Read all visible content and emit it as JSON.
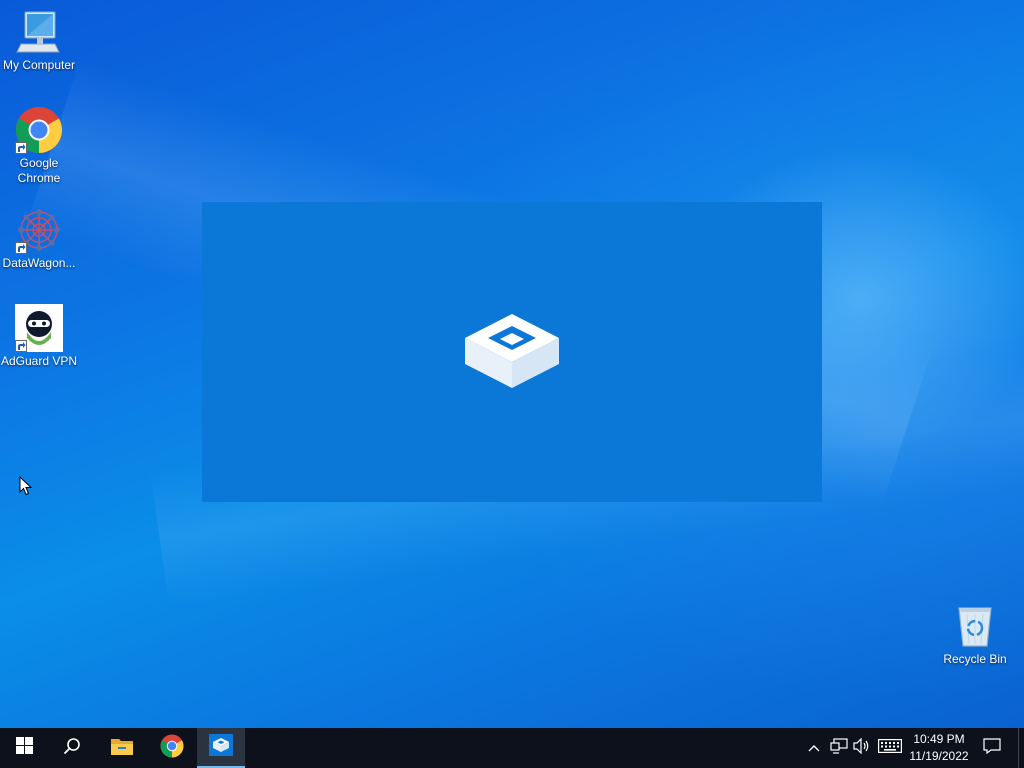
{
  "desktop": {
    "icons": [
      {
        "label": "My Computer",
        "icon": "computer-icon"
      },
      {
        "label": "Google\nChrome",
        "icon": "chrome-icon",
        "shortcut": true
      },
      {
        "label": "DataWagon...",
        "icon": "datawagon-icon",
        "shortcut": true
      },
      {
        "label": "AdGuard VPN",
        "icon": "adguard-vpn-icon",
        "shortcut": true
      },
      {
        "label": "Recycle Bin",
        "icon": "recycle-bin-icon"
      }
    ]
  },
  "splash": {
    "icon": "sandbox-box-icon",
    "color": "#0b78d7"
  },
  "taskbar": {
    "buttons": [
      "start-icon",
      "search-icon",
      "file-explorer-icon",
      "chrome-icon",
      "sandbox-box-icon"
    ],
    "active": "sandbox-box-icon",
    "tray": [
      "chevron-up-icon",
      "network-icon",
      "volume-icon",
      "keyboard-icon",
      "notification-icon"
    ],
    "time": "10:49 PM",
    "date": "11/19/2022",
    "accent": "#76b9ed"
  }
}
